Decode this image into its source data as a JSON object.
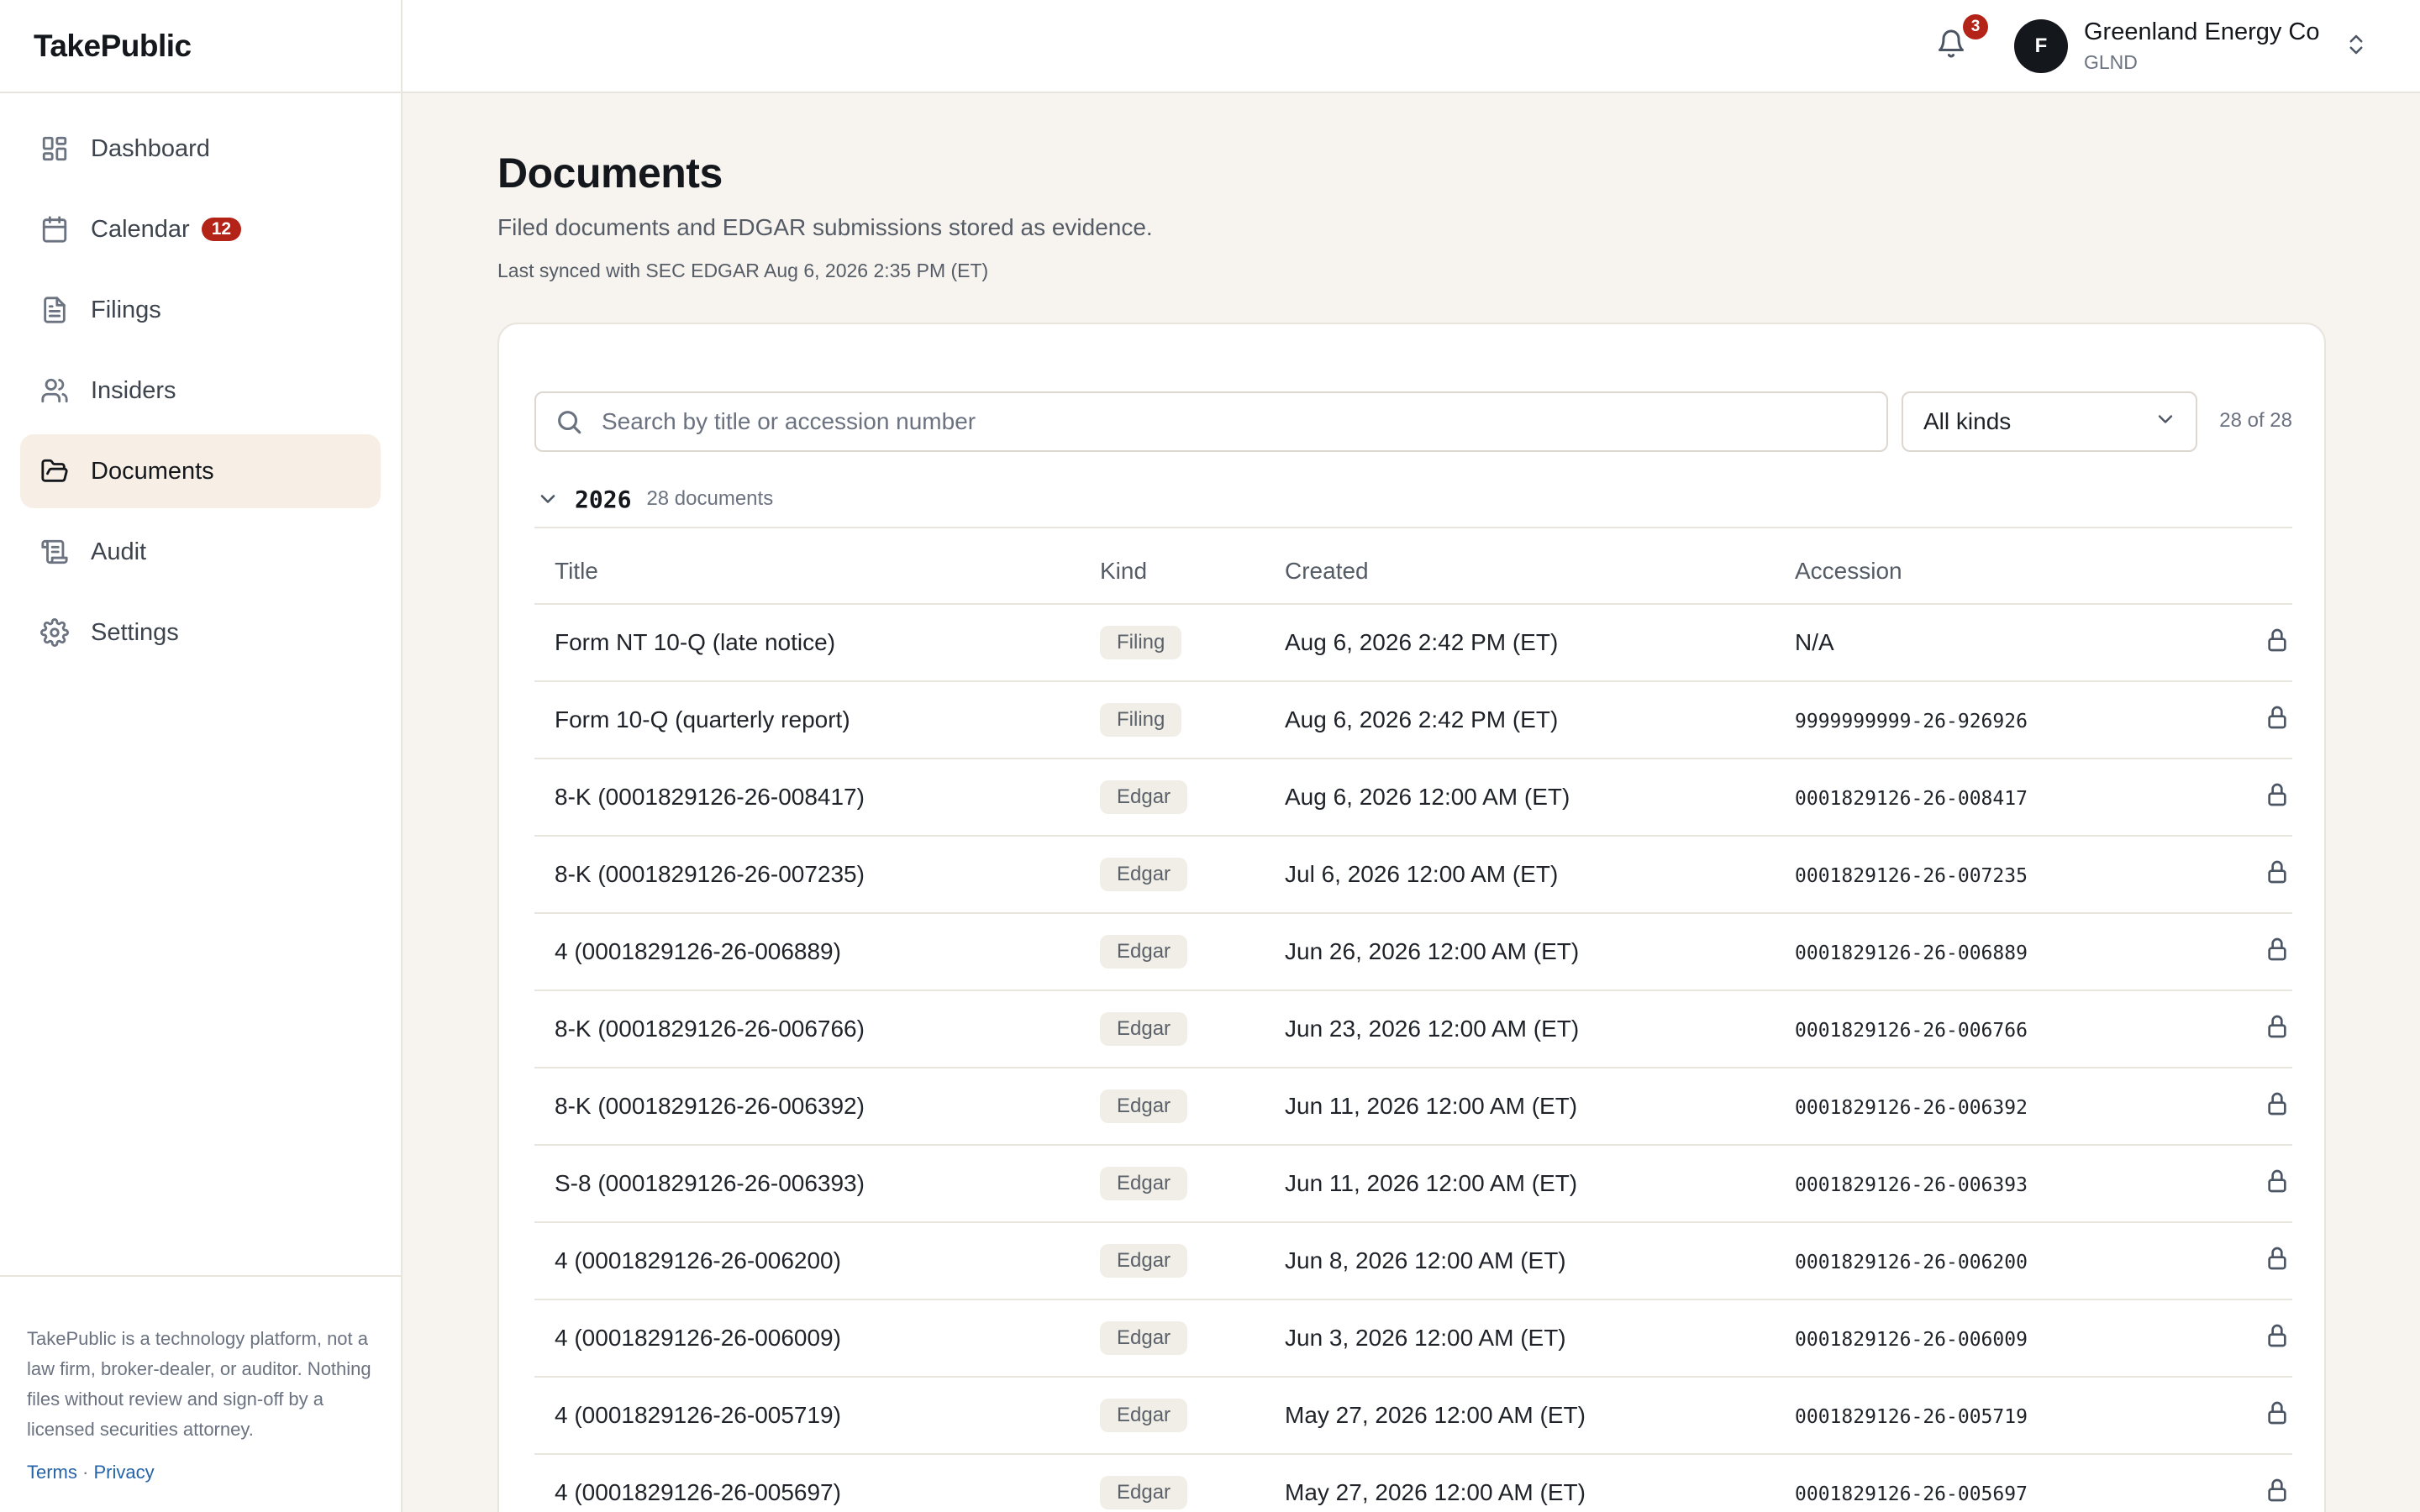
{
  "app": {
    "brand": "TakePublic"
  },
  "sidebar": {
    "items": [
      {
        "label": "Dashboard",
        "icon": "dashboard-icon",
        "active": false
      },
      {
        "label": "Calendar",
        "icon": "calendar-icon",
        "badge": "12",
        "active": false
      },
      {
        "label": "Filings",
        "icon": "file-text-icon",
        "active": false
      },
      {
        "label": "Insiders",
        "icon": "users-icon",
        "active": false
      },
      {
        "label": "Documents",
        "icon": "folder-open-icon",
        "active": true
      },
      {
        "label": "Audit",
        "icon": "scroll-icon",
        "active": false
      },
      {
        "label": "Settings",
        "icon": "gear-icon",
        "active": false
      }
    ],
    "disclaimer": "TakePublic is a technology platform, not a law firm, broker-dealer, or auditor. Nothing files without review and sign-off by a licensed securities attorney.",
    "terms": "Terms",
    "separator": "·",
    "privacy": "Privacy"
  },
  "topbar": {
    "notification_count": "3",
    "avatar_initial": "F",
    "company_name": "Greenland Energy Co",
    "company_ticker": "GLND"
  },
  "page": {
    "title": "Documents",
    "subtitle": "Filed documents and EDGAR submissions stored as evidence.",
    "sync_note": "Last synced with SEC EDGAR Aug 6, 2026 2:35 PM (ET)"
  },
  "filters": {
    "search_placeholder": "Search by title or accession number",
    "search_value": "",
    "kind_selected": "All kinds",
    "result_count": "28 of 28"
  },
  "group": {
    "year": "2026",
    "count_label": "28 documents",
    "expanded": true
  },
  "table": {
    "headers": {
      "title": "Title",
      "kind": "Kind",
      "created": "Created",
      "accession": "Accession"
    },
    "rows": [
      {
        "title": "Form NT 10-Q (late notice)",
        "kind": "Filing",
        "created": "Aug 6, 2026 2:42 PM (ET)",
        "accession": "N/A",
        "mono": false
      },
      {
        "title": "Form 10-Q (quarterly report)",
        "kind": "Filing",
        "created": "Aug 6, 2026 2:42 PM (ET)",
        "accession": "9999999999-26-926926",
        "mono": true
      },
      {
        "title": "8-K (0001829126-26-008417)",
        "kind": "Edgar",
        "created": "Aug 6, 2026 12:00 AM (ET)",
        "accession": "0001829126-26-008417",
        "mono": true
      },
      {
        "title": "8-K (0001829126-26-007235)",
        "kind": "Edgar",
        "created": "Jul 6, 2026 12:00 AM (ET)",
        "accession": "0001829126-26-007235",
        "mono": true
      },
      {
        "title": "4 (0001829126-26-006889)",
        "kind": "Edgar",
        "created": "Jun 26, 2026 12:00 AM (ET)",
        "accession": "0001829126-26-006889",
        "mono": true
      },
      {
        "title": "8-K (0001829126-26-006766)",
        "kind": "Edgar",
        "created": "Jun 23, 2026 12:00 AM (ET)",
        "accession": "0001829126-26-006766",
        "mono": true
      },
      {
        "title": "8-K (0001829126-26-006392)",
        "kind": "Edgar",
        "created": "Jun 11, 2026 12:00 AM (ET)",
        "accession": "0001829126-26-006392",
        "mono": true
      },
      {
        "title": "S-8 (0001829126-26-006393)",
        "kind": "Edgar",
        "created": "Jun 11, 2026 12:00 AM (ET)",
        "accession": "0001829126-26-006393",
        "mono": true
      },
      {
        "title": "4 (0001829126-26-006200)",
        "kind": "Edgar",
        "created": "Jun 8, 2026 12:00 AM (ET)",
        "accession": "0001829126-26-006200",
        "mono": true
      },
      {
        "title": "4 (0001829126-26-006009)",
        "kind": "Edgar",
        "created": "Jun 3, 2026 12:00 AM (ET)",
        "accession": "0001829126-26-006009",
        "mono": true
      },
      {
        "title": "4 (0001829126-26-005719)",
        "kind": "Edgar",
        "created": "May 27, 2026 12:00 AM (ET)",
        "accession": "0001829126-26-005719",
        "mono": true
      },
      {
        "title": "4 (0001829126-26-005697)",
        "kind": "Edgar",
        "created": "May 27, 2026 12:00 AM (ET)",
        "accession": "0001829126-26-005697",
        "mono": true
      }
    ],
    "row_icon": "lock-icon"
  },
  "colors": {
    "page_bg": "#f7f4ef",
    "active_nav_bg": "#f7efe5",
    "badge_red": "#b42318",
    "link_blue": "#2563a8"
  }
}
